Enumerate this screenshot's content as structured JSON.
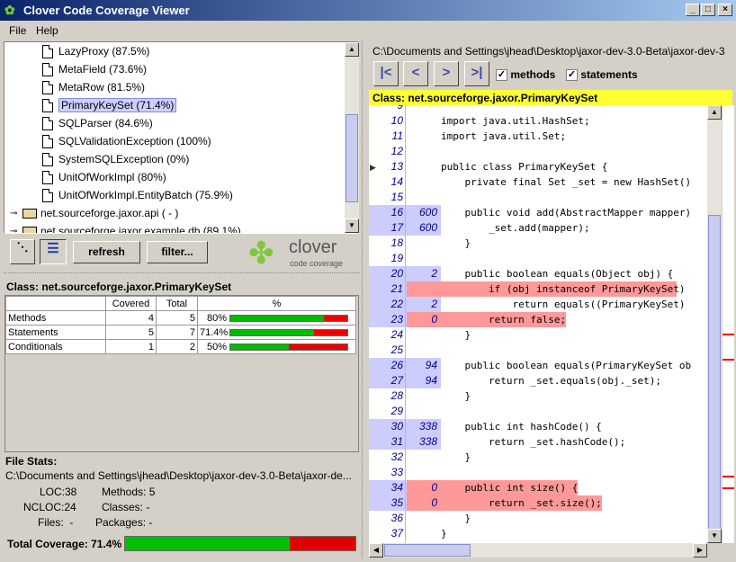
{
  "window": {
    "title": "Clover Code Coverage Viewer"
  },
  "menu": {
    "file": "File",
    "help": "Help"
  },
  "tree": {
    "items": [
      {
        "label": "LazyProxy (87.5%)",
        "type": "doc"
      },
      {
        "label": "MetaField (73.6%)",
        "type": "doc"
      },
      {
        "label": "MetaRow (81.5%)",
        "type": "doc"
      },
      {
        "label": "PrimaryKeySet (71.4%)",
        "type": "doc",
        "selected": true
      },
      {
        "label": "SQLParser (84.6%)",
        "type": "doc"
      },
      {
        "label": "SQLValidationException (100%)",
        "type": "doc"
      },
      {
        "label": "SystemSQLException (0%)",
        "type": "doc"
      },
      {
        "label": "UnitOfWorkImpl (80%)",
        "type": "doc"
      },
      {
        "label": "UnitOfWorkImpl.EntityBatch (75.9%)",
        "type": "doc"
      },
      {
        "label": "net.sourceforge.jaxor.api ( - )",
        "type": "pkg"
      },
      {
        "label": "net.sourceforge.jaxor.example.db (89.1%)",
        "type": "pkg"
      }
    ]
  },
  "toolbar": {
    "refresh": "refresh",
    "filter": "filter...",
    "logo_text": "clover",
    "logo_sub": "code coverage"
  },
  "classpanel": {
    "title": "Class: net.sourceforge.jaxor.PrimaryKeySet",
    "headers": [
      "",
      "Covered",
      "Total",
      "%"
    ],
    "rows": [
      {
        "name": "Methods",
        "covered": "4",
        "total": "5",
        "pct": "80%",
        "value": 0.8
      },
      {
        "name": "Statements",
        "covered": "5",
        "total": "7",
        "pct": "71.4%",
        "value": 0.714
      },
      {
        "name": "Conditionals",
        "covered": "1",
        "total": "2",
        "pct": "50%",
        "value": 0.5
      }
    ]
  },
  "filestats": {
    "title": "File Stats:",
    "path": "C:\\Documents and Settings\\jhead\\Desktop\\jaxor-dev-3.0-Beta\\jaxor-de...",
    "loc": "LOC:38",
    "methods": "Methods: 5",
    "ncloc": "NCLOC:24",
    "classes": "Classes: -",
    "files": "Files:  -",
    "packages": "Packages: -"
  },
  "total": {
    "label": "Total Coverage: 71.4%",
    "value": 0.714
  },
  "source": {
    "path": "C:\\Documents and Settings\\jhead\\Desktop\\jaxor-dev-3.0-Beta\\jaxor-dev-3",
    "methods_label": "methods",
    "statements_label": "statements",
    "class_header": "Class: net.sourceforge.jaxor.PrimaryKeySet",
    "lines": [
      {
        "n": "9",
        "c": "",
        "t": "",
        "s": ""
      },
      {
        "n": "10",
        "c": "",
        "t": "import java.util.HashSet;",
        "s": ""
      },
      {
        "n": "11",
        "c": "",
        "t": "import java.util.Set;",
        "s": ""
      },
      {
        "n": "12",
        "c": "",
        "t": "",
        "s": ""
      },
      {
        "n": "13",
        "c": "",
        "t": "public class PrimaryKeySet {",
        "s": ""
      },
      {
        "n": "14",
        "c": "",
        "t": "    private final Set _set = new HashSet()",
        "s": ""
      },
      {
        "n": "15",
        "c": "",
        "t": "",
        "s": ""
      },
      {
        "n": "16",
        "c": "600",
        "t": "    public void add(AbstractMapper mapper)",
        "s": "cov"
      },
      {
        "n": "17",
        "c": "600",
        "t": "        _set.add(mapper);",
        "s": "cov"
      },
      {
        "n": "18",
        "c": "",
        "t": "    }",
        "s": ""
      },
      {
        "n": "19",
        "c": "",
        "t": "",
        "s": ""
      },
      {
        "n": "20",
        "c": "2",
        "t": "    public boolean equals(Object obj) {",
        "s": "cov"
      },
      {
        "n": "21",
        "c": "2",
        "t": "        if (obj instanceof PrimaryKeySet)",
        "s": "part"
      },
      {
        "n": "22",
        "c": "2",
        "t": "            return equals((PrimaryKeySet)",
        "s": "cov"
      },
      {
        "n": "23",
        "c": "0",
        "t": "        return false;",
        "s": "miss"
      },
      {
        "n": "24",
        "c": "",
        "t": "    }",
        "s": ""
      },
      {
        "n": "25",
        "c": "",
        "t": "",
        "s": ""
      },
      {
        "n": "26",
        "c": "94",
        "t": "    public boolean equals(PrimaryKeySet ob",
        "s": "cov"
      },
      {
        "n": "27",
        "c": "94",
        "t": "        return _set.equals(obj._set);",
        "s": "cov"
      },
      {
        "n": "28",
        "c": "",
        "t": "    }",
        "s": ""
      },
      {
        "n": "29",
        "c": "",
        "t": "",
        "s": ""
      },
      {
        "n": "30",
        "c": "338",
        "t": "    public int hashCode() {",
        "s": "cov"
      },
      {
        "n": "31",
        "c": "338",
        "t": "        return _set.hashCode();",
        "s": "cov"
      },
      {
        "n": "32",
        "c": "",
        "t": "    }",
        "s": ""
      },
      {
        "n": "33",
        "c": "",
        "t": "",
        "s": ""
      },
      {
        "n": "34",
        "c": "0",
        "t": "    public int size() {",
        "s": "miss"
      },
      {
        "n": "35",
        "c": "0",
        "t": "        return _set.size();",
        "s": "miss"
      },
      {
        "n": "36",
        "c": "",
        "t": "    }",
        "s": ""
      },
      {
        "n": "37",
        "c": "",
        "t": "}",
        "s": ""
      }
    ]
  },
  "colors": {
    "covered": "#ccccff",
    "missed": "#ff9999",
    "header": "#ffff33",
    "bar_green": "#00c000",
    "bar_red": "#e00000"
  }
}
